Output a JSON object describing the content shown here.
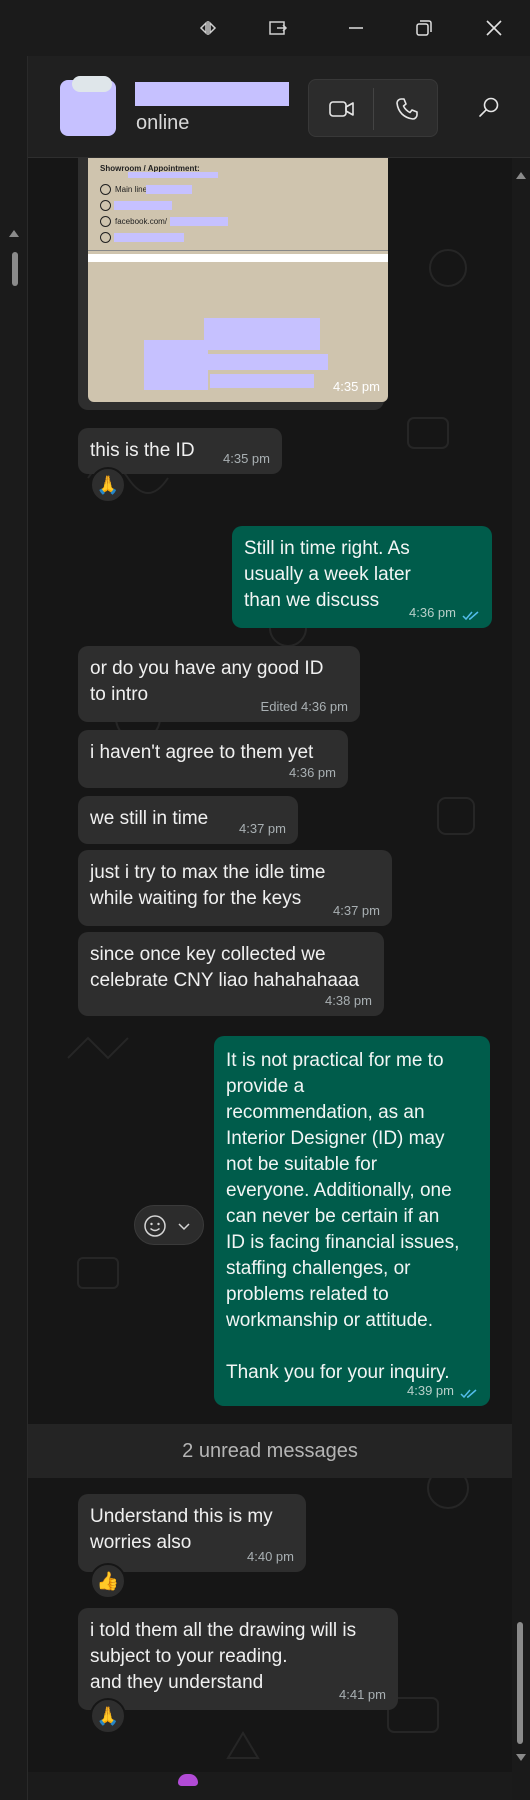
{
  "window": {
    "controls": [
      "split-view-icon",
      "pop-out-icon",
      "minimize-icon",
      "restore-icon",
      "close-icon"
    ]
  },
  "header": {
    "status": "online",
    "actions": [
      "video-call-icon",
      "voice-call-icon",
      "search-icon"
    ]
  },
  "image_message": {
    "card_heading": "Showroom / Appointment:",
    "card_main_line_label": "Main line:",
    "card_facebook": "facebook.com/",
    "time": "4:35 pm"
  },
  "messages": [
    {
      "id": "m1",
      "dir": "in",
      "text": "this is the ID",
      "time": "4:35 pm",
      "reaction": "🙏"
    },
    {
      "id": "m2",
      "dir": "out",
      "text": "Still in time right. As\nusually a week later\nthan we discuss",
      "time": "4:36 pm"
    },
    {
      "id": "m3",
      "dir": "in",
      "text": "or do you have any good ID\nto intro",
      "time": "Edited 4:36 pm"
    },
    {
      "id": "m4",
      "dir": "in",
      "text": "i haven't agree to them yet",
      "time": "4:36 pm"
    },
    {
      "id": "m5",
      "dir": "in",
      "text": "we still in time",
      "time": "4:37 pm"
    },
    {
      "id": "m6",
      "dir": "in",
      "text": "just i try to max the idle time\nwhile waiting for the keys",
      "time": "4:37 pm"
    },
    {
      "id": "m7",
      "dir": "in",
      "text": "since once key collected we\ncelebrate CNY liao hahahahaaa",
      "time": "4:38 pm"
    },
    {
      "id": "m8",
      "dir": "out",
      "text": "It is not practical for me to\nprovide a\nrecommendation, as an\nInterior Designer (ID) may\nnot be suitable for\neveryone. Additionally, one\ncan never be certain if an\nID is facing financial issues,\nstaffing challenges, or\nproblems related to\nworkmanship or attitude.\n\nThank you for your inquiry.",
      "time": "4:39 pm"
    },
    {
      "id": "m9",
      "dir": "in",
      "text": "Understand this is my\nworries also",
      "time": "4:40 pm",
      "reaction": "👍"
    },
    {
      "id": "m10",
      "dir": "in",
      "text": "i told them all the drawing will is\nsubject to your reading.\nand they understand",
      "time": "4:41 pm",
      "reaction": "🙏"
    }
  ],
  "unread_banner": "2 unread messages",
  "colors": {
    "incoming_bubble": "#2e2e2e",
    "outgoing_bubble": "#005c4b",
    "read_ticks": "#53bdeb",
    "redaction": "#c6c1ff"
  }
}
